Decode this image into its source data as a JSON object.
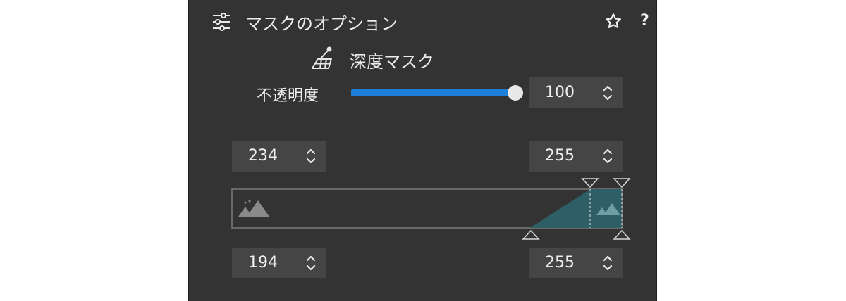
{
  "header": {
    "title": "マスクのオプション",
    "favorite_icon": "star-icon",
    "help_label": "?"
  },
  "depth_mask": {
    "icon": "depth-mask-icon",
    "label": "深度マスク"
  },
  "opacity": {
    "label": "不透明度",
    "value": "100",
    "slider_fraction": 1.0,
    "accent_color": "#1e7fd8"
  },
  "range": {
    "upper_left": "234",
    "upper_right": "255",
    "lower_left": "194",
    "lower_right": "255",
    "fill_color": "#2e5f66"
  }
}
